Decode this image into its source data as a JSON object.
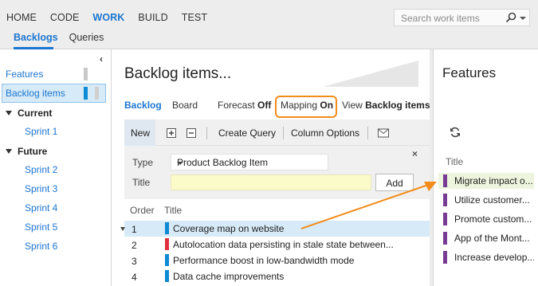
{
  "top_nav": {
    "items": [
      "HOME",
      "CODE",
      "WORK",
      "BUILD",
      "TEST"
    ],
    "active": "WORK",
    "search_placeholder": "Search work items",
    "search_icon": "search-icon"
  },
  "sub_nav": {
    "items": [
      "Backlogs",
      "Queries"
    ],
    "active": "Backlogs"
  },
  "left_pane": {
    "collapse_glyph": "‹",
    "levels": [
      {
        "label": "Features"
      },
      {
        "label": "Backlog items",
        "selected": true
      }
    ],
    "groups": [
      {
        "label": "Current",
        "sprints": [
          "Sprint 1"
        ]
      },
      {
        "label": "Future",
        "sprints": [
          "Sprint 2",
          "Sprint 3",
          "Sprint 4",
          "Sprint 5",
          "Sprint 6"
        ]
      }
    ]
  },
  "main": {
    "title": "Backlog items...",
    "tabs": {
      "backlog": "Backlog",
      "board": "Board",
      "forecast_label": "Forecast",
      "forecast_value": "Off",
      "mapping_label": "Mapping",
      "mapping_value": "On",
      "view_label": "View",
      "view_value": "Backlog items"
    },
    "toolbar": {
      "new_label": "New",
      "expand_icon": "expand-icon",
      "collapse_icon": "collapse-icon",
      "create_query": "Create Query",
      "column_options": "Column Options",
      "email_icon": "email-icon"
    },
    "add_panel": {
      "close_glyph": "×",
      "type_label": "Type",
      "type_value": "Product Backlog Item",
      "title_label": "Title",
      "title_value": "",
      "add_button": "Add"
    },
    "grid": {
      "columns": [
        "Order",
        "Title"
      ],
      "rows": [
        {
          "order": "1",
          "title": "Coverage map on website",
          "color": "#0f8ad4",
          "selected": true
        },
        {
          "order": "2",
          "title": "Autolocation data persisting in stale state between...",
          "color": "#e0303f"
        },
        {
          "order": "3",
          "title": "Performance boost in low-bandwidth mode",
          "color": "#0f8ad4"
        },
        {
          "order": "4",
          "title": "Data cache improvements",
          "color": "#0f8ad4"
        }
      ]
    }
  },
  "right_pane": {
    "title": "Features",
    "refresh_icon": "refresh-icon",
    "column": "Title",
    "items": [
      {
        "title": "Migrate impact o...",
        "highlighted": true
      },
      {
        "title": "Utilize customer..."
      },
      {
        "title": "Promote custom..."
      },
      {
        "title": "App of the Mont..."
      },
      {
        "title": "Increase develop..."
      }
    ],
    "feature_color": "#773b93"
  },
  "colors": {
    "accent": "#1b75d0",
    "callout": "#f28c1b",
    "selection": "#d7eaf7"
  }
}
